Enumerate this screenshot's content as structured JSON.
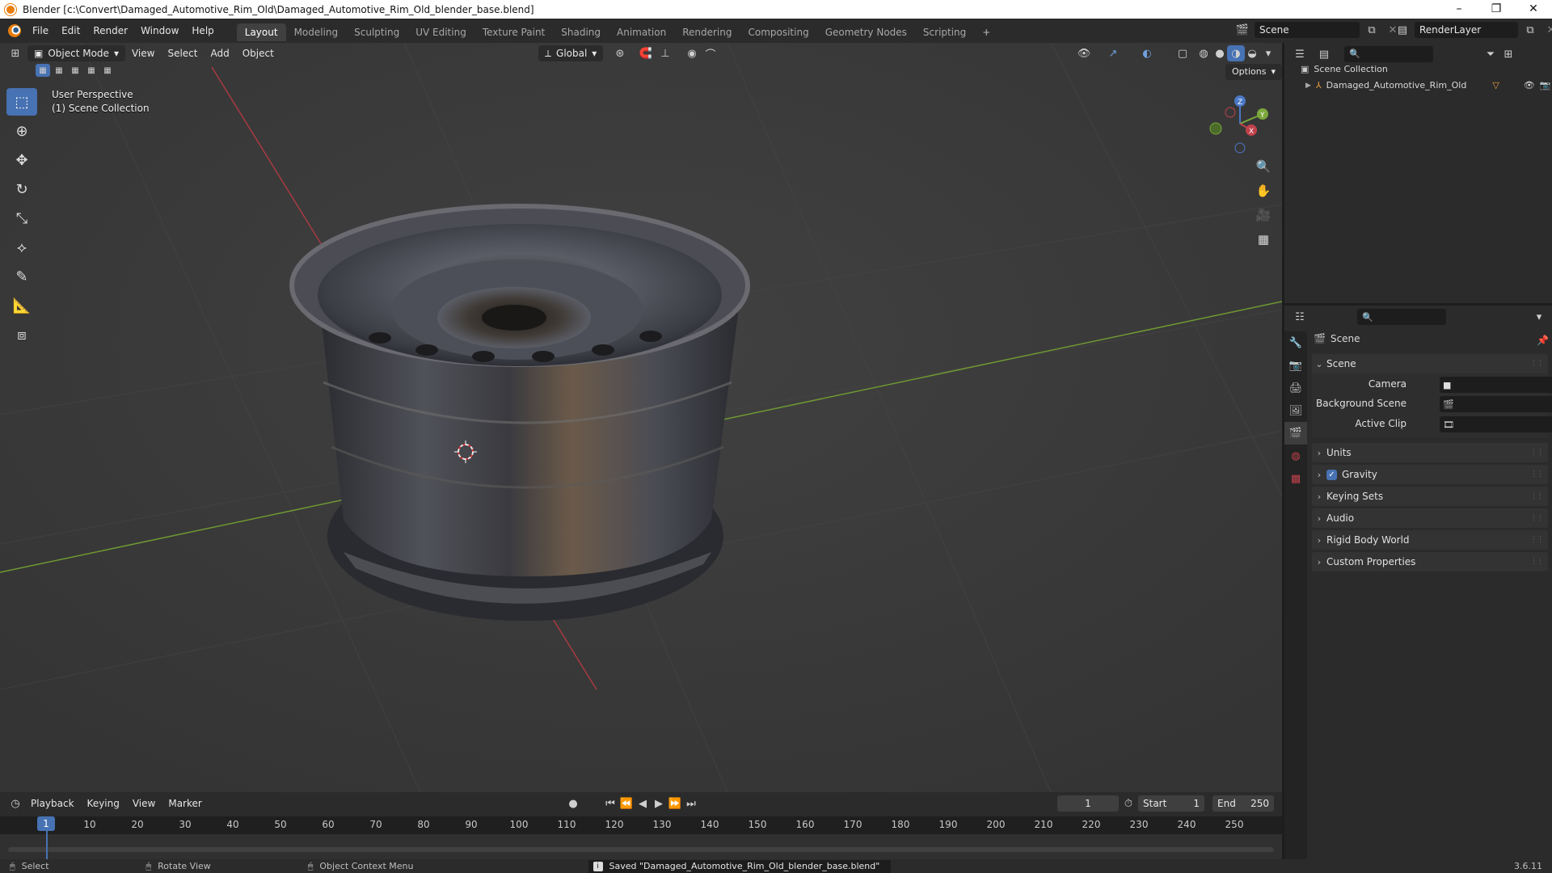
{
  "window": {
    "title": "Blender [c:\\Convert\\Damaged_Automotive_Rim_Old\\Damaged_Automotive_Rim_Old_blender_base.blend]",
    "controls": [
      "–",
      "❐",
      "✕"
    ]
  },
  "menu": [
    "File",
    "Edit",
    "Render",
    "Window",
    "Help"
  ],
  "workspaces": [
    "Layout",
    "Modeling",
    "Sculpting",
    "UV Editing",
    "Texture Paint",
    "Shading",
    "Animation",
    "Rendering",
    "Compositing",
    "Geometry Nodes",
    "Scripting"
  ],
  "active_workspace": "Layout",
  "scene_selector": "Scene",
  "view_layer_selector": "RenderLayer",
  "viewport": {
    "mode": "Object Mode",
    "menu": [
      "View",
      "Select",
      "Add",
      "Object"
    ],
    "transform_orientation": "Global",
    "options_label": "Options",
    "overlay_line1": "User Perspective",
    "overlay_line2": "(1) Scene Collection",
    "gizmo_axes": [
      "X",
      "Y",
      "Z"
    ],
    "colors": {
      "background": "#3b3b3b",
      "x_axis": "#c0424b",
      "y_axis": "#7aa83a",
      "active_tool": "#4772b3"
    }
  },
  "tools": [
    "select-box-icon",
    "cursor-icon",
    "move-icon",
    "rotate-icon",
    "scale-icon",
    "transform-icon",
    "annotate-icon",
    "measure-icon",
    "add-cube-icon"
  ],
  "timeline": {
    "menu": [
      "Playback",
      "Keying",
      "View",
      "Marker"
    ],
    "current_frame": "1",
    "start_label": "Start",
    "start_value": "1",
    "end_label": "End",
    "end_value": "250",
    "playhead": "1",
    "ruler": [
      "10",
      "20",
      "30",
      "40",
      "50",
      "60",
      "70",
      "80",
      "90",
      "100",
      "110",
      "120",
      "130",
      "140",
      "150",
      "160",
      "170",
      "180",
      "190",
      "200",
      "210",
      "220",
      "230",
      "240",
      "250"
    ]
  },
  "status": {
    "select": "Select",
    "rotate": "Rotate View",
    "context_menu": "Object Context Menu",
    "message": "Saved \"Damaged_Automotive_Rim_Old_blender_base.blend\"",
    "version": "3.6.11"
  },
  "outliner": {
    "root": "Scene Collection",
    "items": [
      "Damaged_Automotive_Rim_Old"
    ]
  },
  "properties": {
    "breadcrumb": "Scene",
    "section": "Scene",
    "fields": [
      {
        "label": "Camera",
        "value": ""
      },
      {
        "label": "Background Scene",
        "value": ""
      },
      {
        "label": "Active Clip",
        "value": ""
      }
    ],
    "panels": [
      "Units",
      "Gravity",
      "Keying Sets",
      "Audio",
      "Rigid Body World",
      "Custom Properties"
    ],
    "gravity_checked": true
  }
}
